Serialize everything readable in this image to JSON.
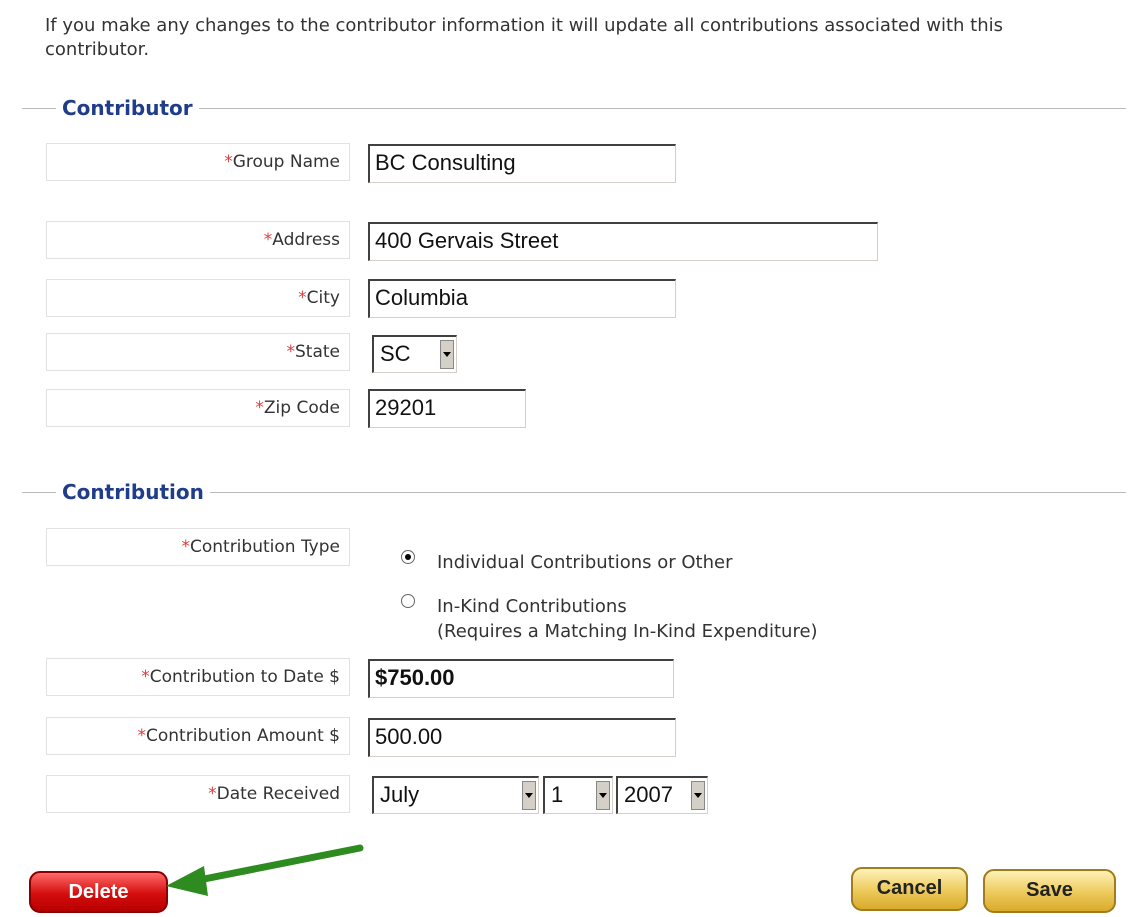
{
  "intro_text": "If you make any changes to the contributor information it will update all contributions associated with this contributor.",
  "contributor_section": {
    "title": "Contributor",
    "group_name": {
      "label": "Group Name",
      "value": "BC Consulting"
    },
    "address": {
      "label": "Address",
      "value": "400 Gervais Street"
    },
    "city": {
      "label": "City",
      "value": "Columbia"
    },
    "state": {
      "label": "State",
      "value": "SC"
    },
    "zip": {
      "label": "Zip Code",
      "value": "29201"
    }
  },
  "contribution_section": {
    "title": "Contribution",
    "type": {
      "label": "Contribution Type",
      "options": [
        {
          "text": "Individual Contributions or Other",
          "checked": true
        },
        {
          "text": "In-Kind Contributions",
          "subtext": "(Requires a Matching In-Kind Expenditure)",
          "checked": false
        }
      ]
    },
    "to_date": {
      "label": "Contribution to Date $",
      "value": "$750.00"
    },
    "amount": {
      "label": "Contribution Amount $",
      "value": "500.00"
    },
    "date_received": {
      "label": "Date Received",
      "month": "July",
      "day": "1",
      "year": "2007"
    }
  },
  "required_marker": "*",
  "buttons": {
    "delete": "Delete",
    "cancel": "Cancel",
    "save": "Save"
  },
  "colors": {
    "accent": "#1f3d8a",
    "required": "#e23b3b",
    "delete": "#d40d0d",
    "gold": "#ecc95a",
    "arrow": "#2e8b1f"
  }
}
